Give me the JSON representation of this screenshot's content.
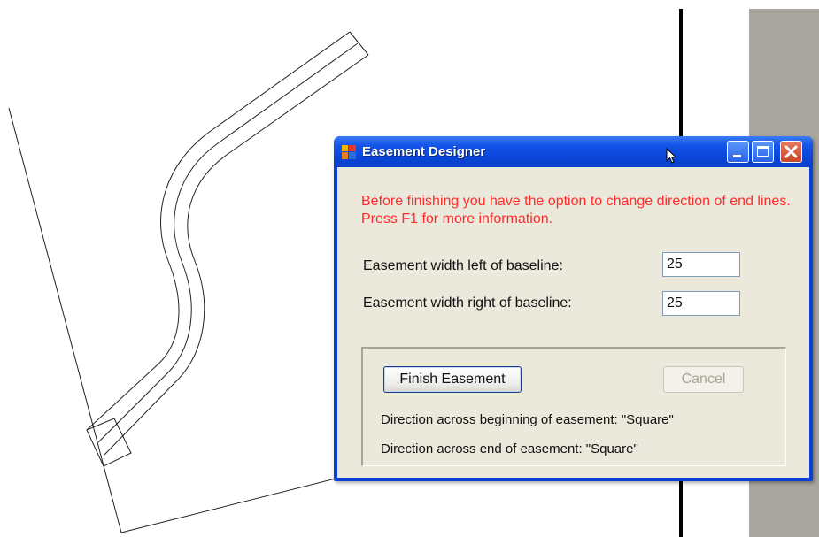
{
  "dialog": {
    "title": "Easement Designer",
    "info_message": "Before finishing you have the option to change direction of end lines.  Press F1 for more information.",
    "info_color": "#ff2b2b",
    "title_icon": "app-icon",
    "window_controls": [
      "minimize-icon",
      "maximize-icon",
      "close-icon"
    ]
  },
  "fields": {
    "left_label": "Easement width left of baseline:",
    "left_value": "25",
    "right_label": "Easement width right of baseline:",
    "right_value": "25"
  },
  "buttons": {
    "finish_label": "Finish Easement",
    "cancel_label": "Cancel",
    "cancel_enabled": false
  },
  "status": {
    "begin_direction": "Direction across beginning of easement: \"Square\"",
    "end_direction": "Direction across end of easement: \"Square\""
  },
  "colors": {
    "titlebar": "#0a45d8",
    "dialog_face": "#ebe9dc",
    "close_button": "#c94627"
  }
}
